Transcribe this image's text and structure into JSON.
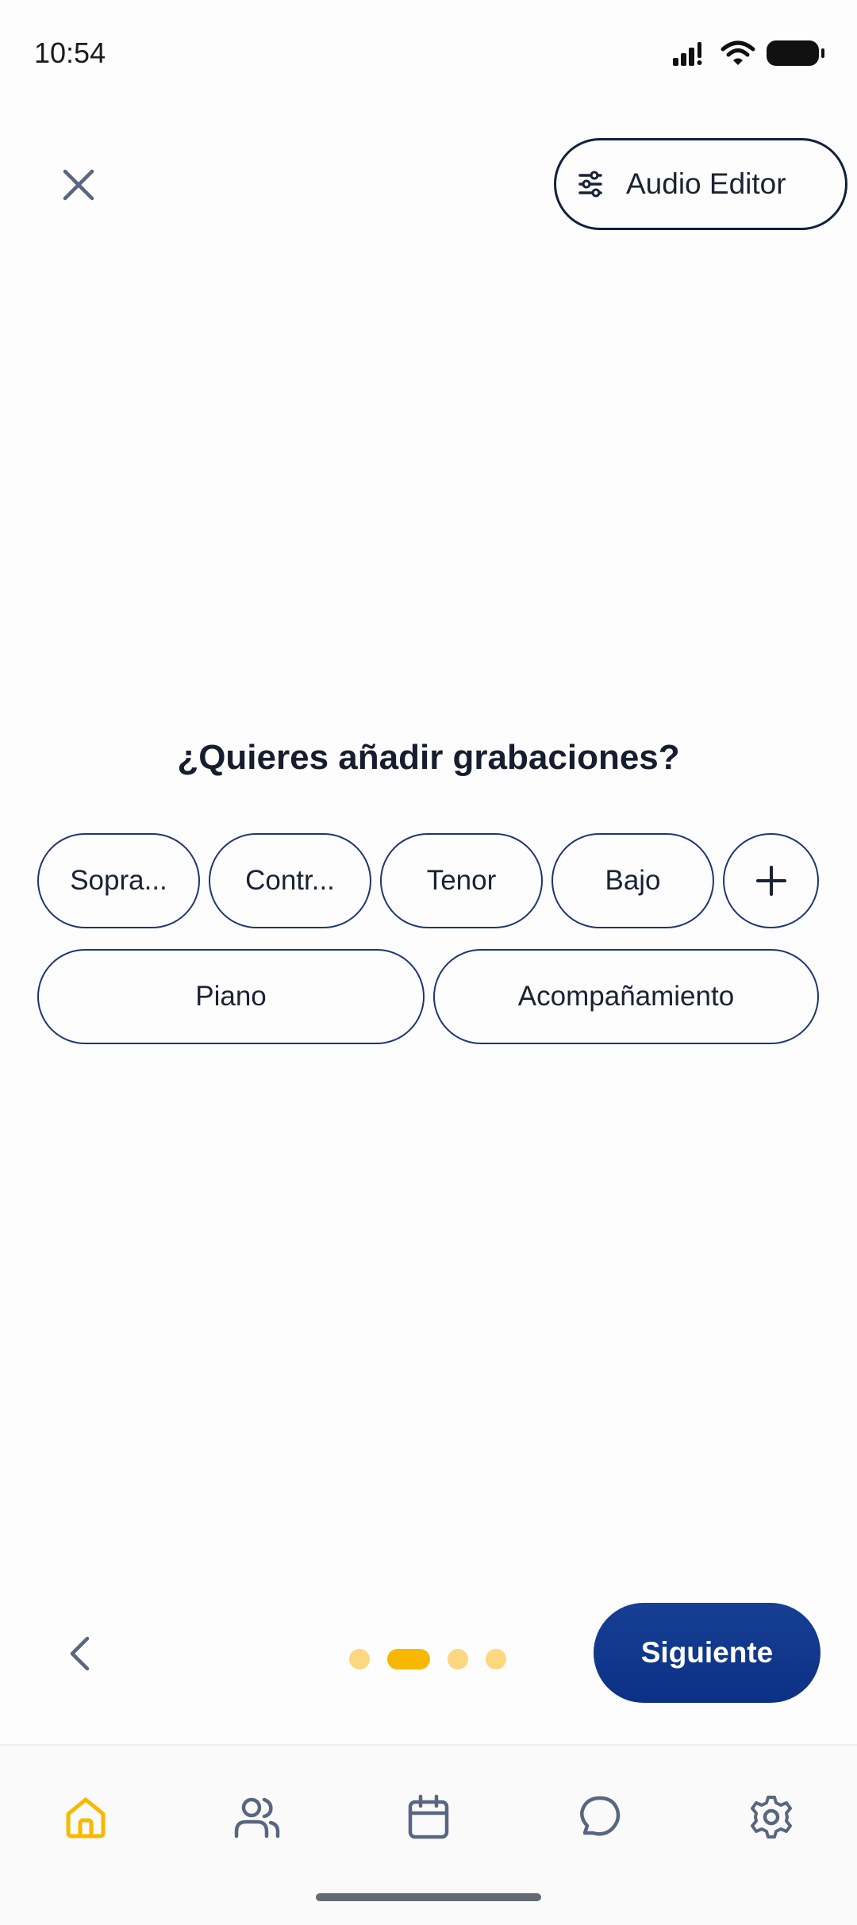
{
  "status_bar": {
    "time": "10:54"
  },
  "header": {
    "audio_editor_label": "Audio Editor"
  },
  "question": "¿Quieres añadir grabaciones?",
  "chips_row1": [
    "Sopra...",
    "Contr...",
    "Tenor",
    "Bajo"
  ],
  "chips_row2": [
    "Piano",
    "Acompañamiento"
  ],
  "add_chip_icon": "plus-icon",
  "pager": {
    "total": 4,
    "current": 2
  },
  "footer": {
    "next_label": "Siguiente"
  },
  "tabbar": {
    "items": [
      {
        "icon": "home-icon",
        "active": true
      },
      {
        "icon": "users-icon",
        "active": false
      },
      {
        "icon": "calendar-icon",
        "active": false
      },
      {
        "icon": "chat-icon",
        "active": false
      },
      {
        "icon": "gear-icon",
        "active": false
      }
    ]
  },
  "colors": {
    "accent": "#f8b800",
    "primary": "#0c3186",
    "chip_border": "#1f3572",
    "icon_gray": "#59667f"
  }
}
